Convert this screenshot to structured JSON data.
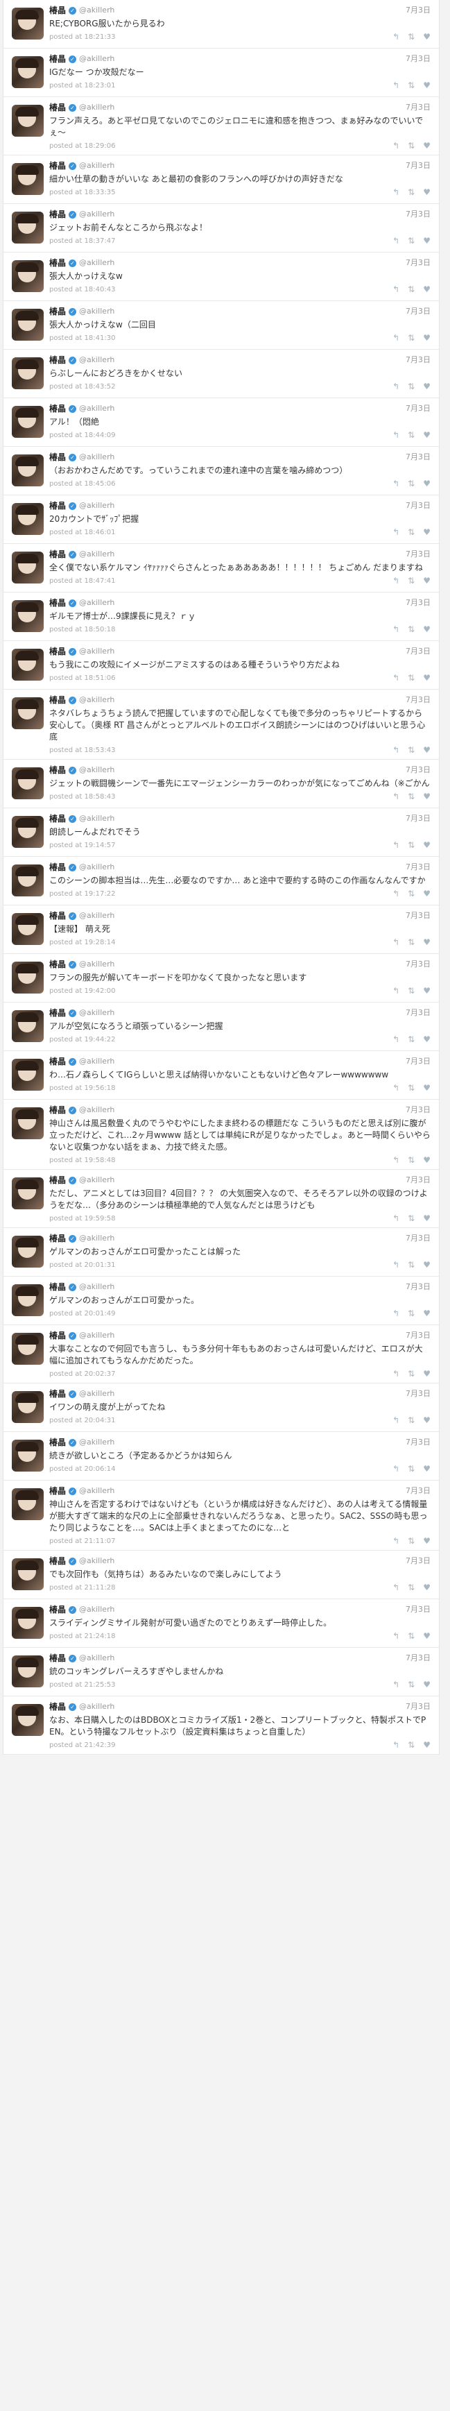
{
  "account": {
    "name": "椿晶",
    "handle": "@akillerh",
    "posted_prefix": "posted at "
  },
  "icons": {
    "verified": "verified-icon",
    "reply": "reply-icon",
    "retweet": "retweet-icon",
    "like": "heart-icon"
  },
  "tweets": [
    {
      "date": "7月3日",
      "text": "RE;CYBORG服いたから見るわ",
      "time": "18:21:33"
    },
    {
      "date": "7月3日",
      "text": "IGだなー つか攻殻だなー",
      "time": "18:23:01"
    },
    {
      "date": "7月3日",
      "text": "フラン声えろ。あと平ゼロ見てないのでこのジェロニモに違和感を抱きつつ、まぁ好みなのでいいでぇ〜",
      "time": "18:29:06"
    },
    {
      "date": "7月3日",
      "text": "細かい仕草の動きがいいな あと最初の食影のフランへの呼びかけの声好きだな",
      "time": "18:33:35"
    },
    {
      "date": "7月3日",
      "text": "ジェットお前そんなところから飛ぶなよ！",
      "time": "18:37:47"
    },
    {
      "date": "7月3日",
      "text": "張大人かっけえなw",
      "time": "18:40:43"
    },
    {
      "date": "7月3日",
      "text": "張大人かっけえなw（二回目",
      "time": "18:41:30"
    },
    {
      "date": "7月3日",
      "text": "らぶしーんにおどろきをかくせない",
      "time": "18:43:52"
    },
    {
      "date": "7月3日",
      "text": "アル！（悶絶",
      "time": "18:44:09"
    },
    {
      "date": "7月3日",
      "text": "（おおかわさんだめです。っていうこれまでの連れ達中の言葉を噛み締めつつ）",
      "time": "18:45:06"
    },
    {
      "date": "7月3日",
      "text": "20カウントでｻﾞｯﾌﾟ把握",
      "time": "18:46:01"
    },
    {
      "date": "7月3日",
      "text": "全く僕でない系ケルマン ｲﾔｧｧｧｧぐらさんとったぁあああああ！！！！！！ ちょごめん だまりますね",
      "time": "18:47:41"
    },
    {
      "date": "7月3日",
      "text": "ギルモア博士が…9課課長に見え？ｒｙ",
      "time": "18:50:18"
    },
    {
      "date": "7月3日",
      "text": "もう我にこの攻殻にイメージがニアミスするのはある種そういうやり方だよね",
      "time": "18:51:06"
    },
    {
      "date": "7月3日",
      "text": "ネタバレちょうちょう読んで把握していますので心配しなくても後で多分のっちゃリピートするから安心して。（奥様 RT 昌さんがとっとアルベルトのエロボイス朗読シーンにはのつひげはいいと思う心底",
      "time": "18:53:43"
    },
    {
      "date": "7月3日",
      "text": "ジェットの戦闘機シーンで一番先にエマージェンシーカラーのわっかが気になってごめんね（※ごかん",
      "time": "18:58:43"
    },
    {
      "date": "7月3日",
      "text": "朗読しーんよだれでそう",
      "time": "19:14:57"
    },
    {
      "date": "7月3日",
      "text": "このシーンの脚本担当は…先生…必要なのですか… あと途中で要約する時のこの作画なんなんですか",
      "time": "19:17:22"
    },
    {
      "date": "7月3日",
      "text": "【速報】 萌え死",
      "time": "19:28:14"
    },
    {
      "date": "7月3日",
      "text": "フランの服先が解いてキーボードを叩かなくて良かったなと思います",
      "time": "19:42:00"
    },
    {
      "date": "7月3日",
      "text": "アルが空気になろうと頑張っているシーン把握",
      "time": "19:44:22"
    },
    {
      "date": "7月3日",
      "text": "わ…石ノ森らしくてIGらしいと思えば納得いかないこともないけど色々アレーwwwwwww",
      "time": "19:56:18"
    },
    {
      "date": "7月3日",
      "text": "神山さんは風呂敷畳く丸のでうやむやにしたまま終わるの標題だな こういうものだと思えば別に腹が立っただけど、これ…2ヶ月wwww 話としては単純にRが足りなかったでしょ。あと一時間くらいやらないと収集つかない話をまぁ、力技で終えた感。",
      "time": "19:58:48"
    },
    {
      "date": "7月3日",
      "text": "ただし、アニメとしては3回目？4回目？？？ の大気圏突入なので、そろそろアレ以外の収録のつけようをだな…（多分あのシーンは積極準絶的で人気なんだとは思うけども",
      "time": "19:59:58"
    },
    {
      "date": "7月3日",
      "text": "ゲルマンのおっさんがエロ可愛かったことは解った",
      "time": "20:01:31"
    },
    {
      "date": "7月3日",
      "text": "ゲルマンのおっさんがエロ可愛かった。",
      "time": "20:01:49"
    },
    {
      "date": "7月3日",
      "text": "大事なことなので何回でも言うし、もう多分何十年ももあのおっさんは可愛いんだけど、エロスが大幅に追加されてもうなんかだめだった。",
      "time": "20:02:37"
    },
    {
      "date": "7月3日",
      "text": "イワンの萌え度が上がってたね",
      "time": "20:04:31"
    },
    {
      "date": "7月3日",
      "text": "続きが欲しいところ（予定あるかどうかは知らん",
      "time": "20:06:14"
    },
    {
      "date": "7月3日",
      "text": "神山さんを否定するわけではないけども（というか構成は好きなんだけど）、あの人は考えてる情報量が膨大すぎて端末的な尺の上に全部乗せきれないんだろうなぁ、と思ったり。SAC2、SSSの時も思ったり同じようなことを…。SACは上手くまとまってたのにな…と",
      "time": "21:11:07"
    },
    {
      "date": "7月3日",
      "text": "でも次回作も（気持ちは）あるみたいなので楽しみにしてよう",
      "time": "21:11:28"
    },
    {
      "date": "7月3日",
      "text": "スライディングミサイル発射が可愛い過ぎたのでとりあえず一時停止した。",
      "time": "21:24:18"
    },
    {
      "date": "7月3日",
      "text": "銃のコッキングレバーえろすぎやしませんかね",
      "time": "21:25:53"
    },
    {
      "date": "7月3日",
      "text": "なお、本日購入したのはBDBOXとコミカライズ版1・2巻と、コンプリートブックと、特製ポストでPEN。という特撮なフルセットぶり（設定資料集はちょっと自重した）",
      "time": "21:42:39"
    }
  ]
}
